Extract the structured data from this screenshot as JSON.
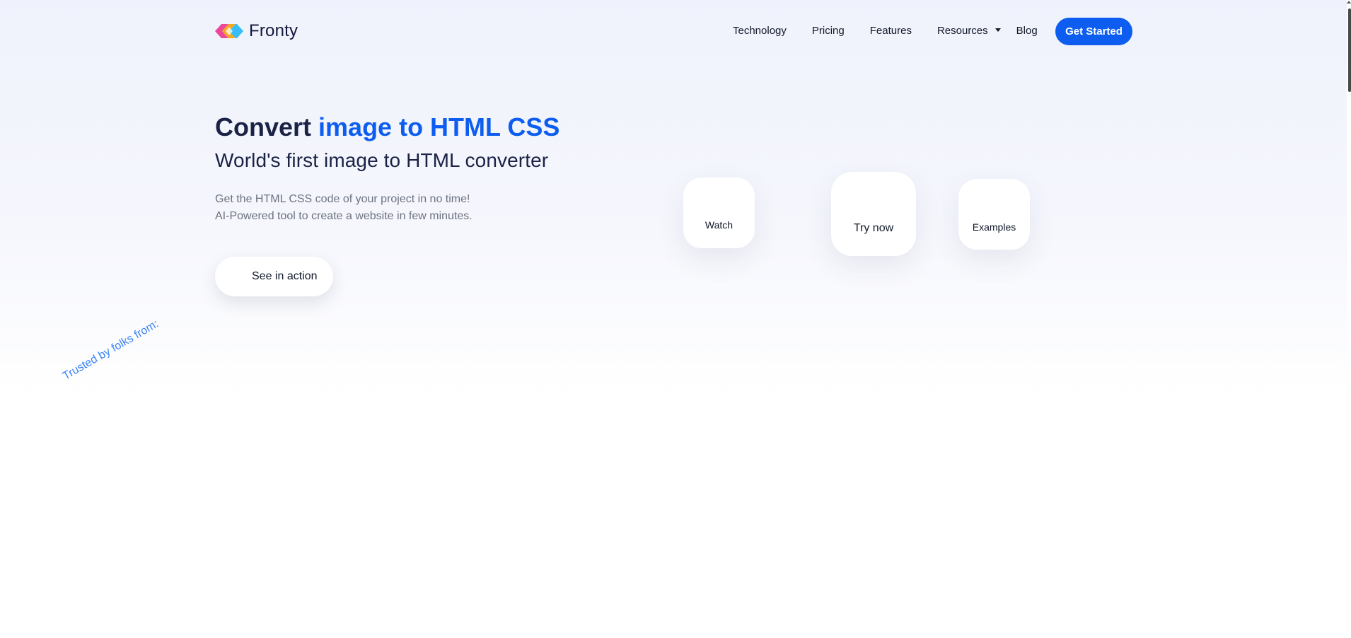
{
  "header": {
    "brand": "Fronty",
    "nav": {
      "technology": "Technology",
      "pricing": "Pricing",
      "features": "Features",
      "resources": "Resources",
      "blog": "Blog"
    },
    "cta": "Get Started"
  },
  "hero": {
    "title_prefix": "Convert ",
    "title_accent": "image to HTML CSS",
    "subtitle": "World's first image to HTML converter",
    "desc_line1": "Get the HTML CSS code of your project in no time!",
    "desc_line2": "AI-Powered tool to create a website in few minutes.",
    "action": "See in action"
  },
  "cards": {
    "watch": "Watch",
    "try_now": "Try now",
    "examples": "Examples"
  },
  "trusted": "Trusted by folks from:",
  "icons": {
    "logo": "fronty-logo-icon",
    "resources_caret": "chevron-down-icon"
  },
  "colors": {
    "accent": "#0d5ef0",
    "heading": "#1a2346",
    "muted": "#6b7280",
    "trusted": "#3b82f6"
  }
}
